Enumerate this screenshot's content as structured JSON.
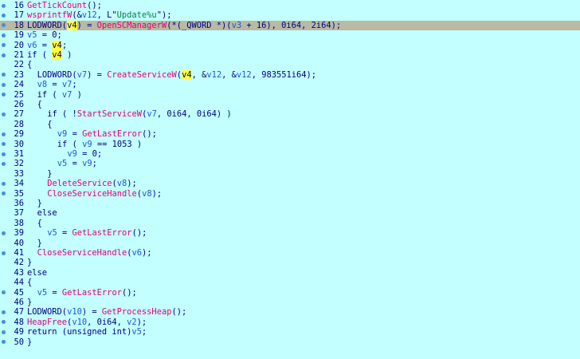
{
  "editor": {
    "lines": [
      {
        "n": "16",
        "dot": true,
        "indent": "",
        "tokens": [
          {
            "t": "fn",
            "v": "GetTickCount"
          },
          {
            "t": "punc",
            "v": "();"
          }
        ]
      },
      {
        "n": "17",
        "dot": true,
        "indent": "",
        "tokens": [
          {
            "t": "fn",
            "v": "wsprintfW"
          },
          {
            "t": "punc",
            "v": "(&"
          },
          {
            "t": "var",
            "v": "v12"
          },
          {
            "t": "punc",
            "v": ", L\""
          },
          {
            "t": "str",
            "v": "Update%u"
          },
          {
            "t": "punc",
            "v": "\");"
          }
        ]
      },
      {
        "n": "18",
        "dot": true,
        "indent": "",
        "current": true,
        "tokens": [
          {
            "t": "kw",
            "v": "LODWORD"
          },
          {
            "t": "punc",
            "v": "("
          },
          {
            "t": "hl",
            "v": "v4"
          },
          {
            "t": "punc",
            "v": ") = "
          },
          {
            "t": "fn",
            "v": "OpenSCManagerW"
          },
          {
            "t": "punc",
            "v": "(*("
          },
          {
            "t": "kw",
            "v": "_QWORD"
          },
          {
            "t": "punc",
            "v": " *)("
          },
          {
            "t": "var",
            "v": "v3"
          },
          {
            "t": "punc",
            "v": " + 16), 0i64, 2i64);"
          }
        ]
      },
      {
        "n": "19",
        "dot": true,
        "indent": "",
        "tokens": [
          {
            "t": "var",
            "v": "v5"
          },
          {
            "t": "punc",
            "v": " = 0;"
          }
        ]
      },
      {
        "n": "20",
        "dot": true,
        "indent": "",
        "tokens": [
          {
            "t": "var",
            "v": "v6"
          },
          {
            "t": "punc",
            "v": " = "
          },
          {
            "t": "hl",
            "v": "v4"
          },
          {
            "t": "punc",
            "v": ";"
          }
        ]
      },
      {
        "n": "21",
        "dot": true,
        "indent": "",
        "tokens": [
          {
            "t": "kw",
            "v": "if"
          },
          {
            "t": "punc",
            "v": " ( "
          },
          {
            "t": "hl",
            "v": "v4"
          },
          {
            "t": "punc",
            "v": " )"
          }
        ]
      },
      {
        "n": "22",
        "dot": false,
        "indent": "",
        "tokens": [
          {
            "t": "punc",
            "v": "{"
          }
        ]
      },
      {
        "n": "23",
        "dot": true,
        "indent": "  ",
        "tokens": [
          {
            "t": "kw",
            "v": "LODWORD"
          },
          {
            "t": "punc",
            "v": "("
          },
          {
            "t": "var",
            "v": "v7"
          },
          {
            "t": "punc",
            "v": ") = "
          },
          {
            "t": "fn",
            "v": "CreateServiceW"
          },
          {
            "t": "punc",
            "v": "("
          },
          {
            "t": "hl",
            "v": "v4"
          },
          {
            "t": "punc",
            "v": ", &"
          },
          {
            "t": "var",
            "v": "v12"
          },
          {
            "t": "punc",
            "v": ", &"
          },
          {
            "t": "var",
            "v": "v12"
          },
          {
            "t": "punc",
            "v": ", 983551i64);"
          }
        ]
      },
      {
        "n": "24",
        "dot": true,
        "indent": "  ",
        "tokens": [
          {
            "t": "var",
            "v": "v8"
          },
          {
            "t": "punc",
            "v": " = "
          },
          {
            "t": "var",
            "v": "v7"
          },
          {
            "t": "punc",
            "v": ";"
          }
        ]
      },
      {
        "n": "25",
        "dot": true,
        "indent": "  ",
        "tokens": [
          {
            "t": "kw",
            "v": "if"
          },
          {
            "t": "punc",
            "v": " ( "
          },
          {
            "t": "var",
            "v": "v7"
          },
          {
            "t": "punc",
            "v": " )"
          }
        ]
      },
      {
        "n": "26",
        "dot": false,
        "indent": "  ",
        "tokens": [
          {
            "t": "punc",
            "v": "{"
          }
        ]
      },
      {
        "n": "27",
        "dot": true,
        "indent": "    ",
        "tokens": [
          {
            "t": "kw",
            "v": "if"
          },
          {
            "t": "punc",
            "v": " ( !"
          },
          {
            "t": "fn",
            "v": "StartServiceW"
          },
          {
            "t": "punc",
            "v": "("
          },
          {
            "t": "var",
            "v": "v7"
          },
          {
            "t": "punc",
            "v": ", 0i64, 0i64) )"
          }
        ]
      },
      {
        "n": "28",
        "dot": false,
        "indent": "    ",
        "tokens": [
          {
            "t": "punc",
            "v": "{"
          }
        ]
      },
      {
        "n": "29",
        "dot": true,
        "indent": "      ",
        "tokens": [
          {
            "t": "var",
            "v": "v9"
          },
          {
            "t": "punc",
            "v": " = "
          },
          {
            "t": "fn",
            "v": "GetLastError"
          },
          {
            "t": "punc",
            "v": "();"
          }
        ]
      },
      {
        "n": "30",
        "dot": true,
        "indent": "      ",
        "tokens": [
          {
            "t": "kw",
            "v": "if"
          },
          {
            "t": "punc",
            "v": " ( "
          },
          {
            "t": "var",
            "v": "v9"
          },
          {
            "t": "punc",
            "v": " == 1053 )"
          }
        ]
      },
      {
        "n": "31",
        "dot": true,
        "indent": "        ",
        "tokens": [
          {
            "t": "var",
            "v": "v9"
          },
          {
            "t": "punc",
            "v": " = 0;"
          }
        ]
      },
      {
        "n": "32",
        "dot": true,
        "indent": "      ",
        "tokens": [
          {
            "t": "var",
            "v": "v5"
          },
          {
            "t": "punc",
            "v": " = "
          },
          {
            "t": "var",
            "v": "v9"
          },
          {
            "t": "punc",
            "v": ";"
          }
        ]
      },
      {
        "n": "33",
        "dot": false,
        "indent": "    ",
        "tokens": [
          {
            "t": "punc",
            "v": "}"
          }
        ]
      },
      {
        "n": "34",
        "dot": true,
        "indent": "    ",
        "tokens": [
          {
            "t": "fn",
            "v": "DeleteService"
          },
          {
            "t": "punc",
            "v": "("
          },
          {
            "t": "var",
            "v": "v8"
          },
          {
            "t": "punc",
            "v": ");"
          }
        ]
      },
      {
        "n": "35",
        "dot": true,
        "indent": "    ",
        "tokens": [
          {
            "t": "fn",
            "v": "CloseServiceHandle"
          },
          {
            "t": "punc",
            "v": "("
          },
          {
            "t": "var",
            "v": "v8"
          },
          {
            "t": "punc",
            "v": ");"
          }
        ]
      },
      {
        "n": "36",
        "dot": false,
        "indent": "  ",
        "tokens": [
          {
            "t": "punc",
            "v": "}"
          }
        ]
      },
      {
        "n": "37",
        "dot": false,
        "indent": "  ",
        "tokens": [
          {
            "t": "kw",
            "v": "else"
          }
        ]
      },
      {
        "n": "38",
        "dot": false,
        "indent": "  ",
        "tokens": [
          {
            "t": "punc",
            "v": "{"
          }
        ]
      },
      {
        "n": "39",
        "dot": true,
        "indent": "    ",
        "tokens": [
          {
            "t": "var",
            "v": "v5"
          },
          {
            "t": "punc",
            "v": " = "
          },
          {
            "t": "fn",
            "v": "GetLastError"
          },
          {
            "t": "punc",
            "v": "();"
          }
        ]
      },
      {
        "n": "40",
        "dot": false,
        "indent": "  ",
        "tokens": [
          {
            "t": "punc",
            "v": "}"
          }
        ]
      },
      {
        "n": "41",
        "dot": true,
        "indent": "  ",
        "tokens": [
          {
            "t": "fn",
            "v": "CloseServiceHandle"
          },
          {
            "t": "punc",
            "v": "("
          },
          {
            "t": "var",
            "v": "v6"
          },
          {
            "t": "punc",
            "v": ");"
          }
        ]
      },
      {
        "n": "42",
        "dot": false,
        "indent": "",
        "tokens": [
          {
            "t": "punc",
            "v": "}"
          }
        ]
      },
      {
        "n": "43",
        "dot": false,
        "indent": "",
        "tokens": [
          {
            "t": "kw",
            "v": "else"
          }
        ]
      },
      {
        "n": "44",
        "dot": false,
        "indent": "",
        "tokens": [
          {
            "t": "punc",
            "v": "{"
          }
        ]
      },
      {
        "n": "45",
        "dot": true,
        "indent": "  ",
        "tokens": [
          {
            "t": "var",
            "v": "v5"
          },
          {
            "t": "punc",
            "v": " = "
          },
          {
            "t": "fn",
            "v": "GetLastError"
          },
          {
            "t": "punc",
            "v": "();"
          }
        ]
      },
      {
        "n": "46",
        "dot": false,
        "indent": "",
        "tokens": [
          {
            "t": "punc",
            "v": "}"
          }
        ]
      },
      {
        "n": "47",
        "dot": true,
        "indent": "",
        "tokens": [
          {
            "t": "kw",
            "v": "LODWORD"
          },
          {
            "t": "punc",
            "v": "("
          },
          {
            "t": "var",
            "v": "v10"
          },
          {
            "t": "punc",
            "v": ") = "
          },
          {
            "t": "fn",
            "v": "GetProcessHeap"
          },
          {
            "t": "punc",
            "v": "();"
          }
        ]
      },
      {
        "n": "48",
        "dot": true,
        "indent": "",
        "tokens": [
          {
            "t": "fn",
            "v": "HeapFree"
          },
          {
            "t": "punc",
            "v": "("
          },
          {
            "t": "var",
            "v": "v10"
          },
          {
            "t": "punc",
            "v": ", 0i64, "
          },
          {
            "t": "var",
            "v": "v2"
          },
          {
            "t": "punc",
            "v": ");"
          }
        ]
      },
      {
        "n": "49",
        "dot": true,
        "indent": "",
        "tokens": [
          {
            "t": "kw",
            "v": "return"
          },
          {
            "t": "punc",
            "v": " ("
          },
          {
            "t": "kw",
            "v": "unsigned int"
          },
          {
            "t": "punc",
            "v": ")"
          },
          {
            "t": "var",
            "v": "v5"
          },
          {
            "t": "punc",
            "v": ";"
          }
        ]
      },
      {
        "n": "50",
        "dot": true,
        "indent": "",
        "tokens": [
          {
            "t": "punc",
            "v": "}"
          }
        ]
      }
    ]
  }
}
